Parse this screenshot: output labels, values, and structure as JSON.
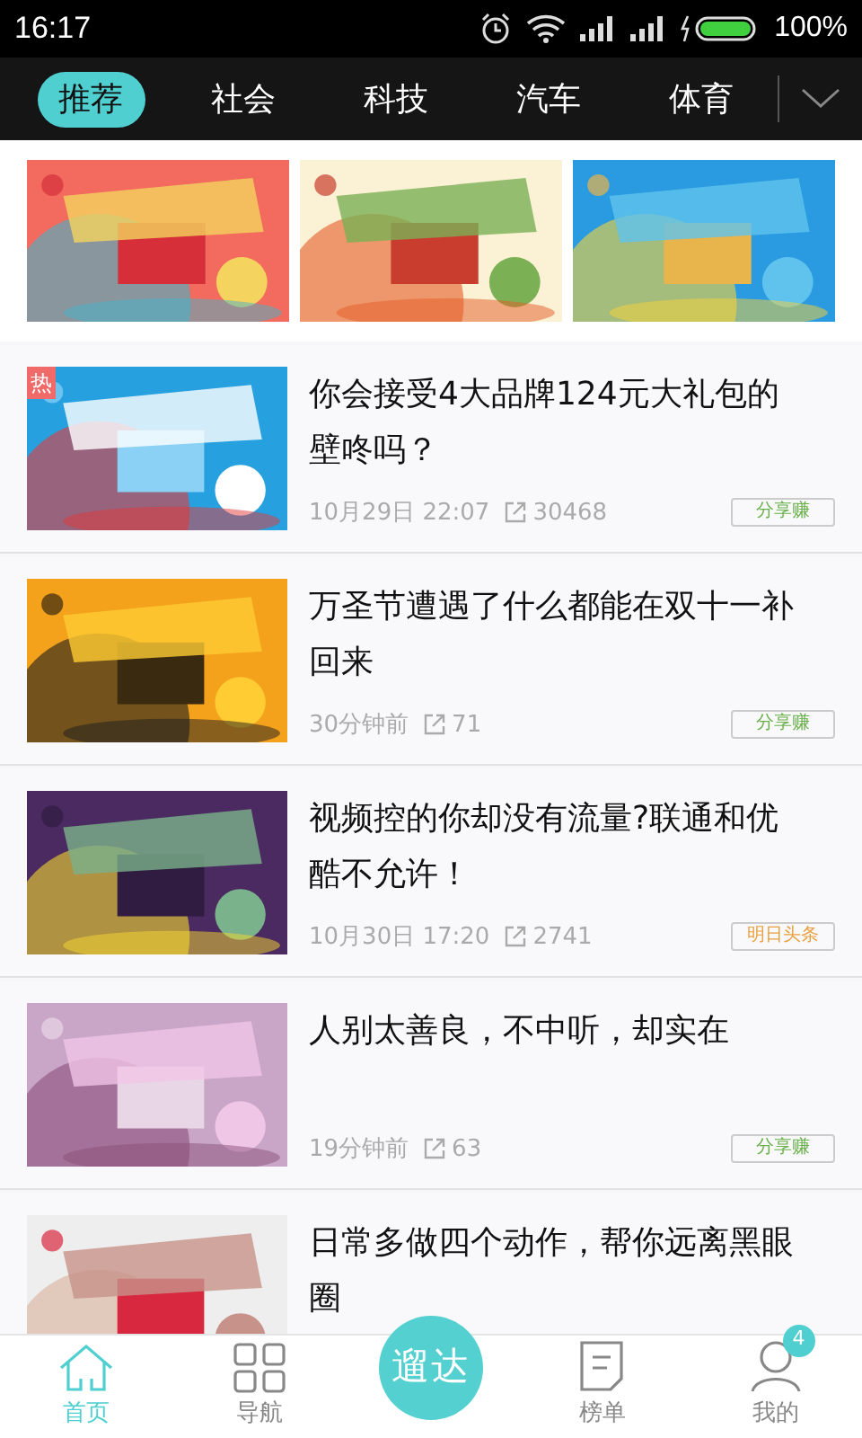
{
  "status_bar": {
    "time": "16:17",
    "battery": "100%"
  },
  "channel_tabs": [
    {
      "label": "推荐",
      "selected": true
    },
    {
      "label": "社会",
      "selected": false
    },
    {
      "label": "科技",
      "selected": false
    },
    {
      "label": "汽车",
      "selected": false
    },
    {
      "label": "体育",
      "selected": false
    }
  ],
  "articles": [
    {
      "title": "你会接受4大品牌124元大礼包的壁咚吗？",
      "badge": "热",
      "time": "10月29日 22:07",
      "shares": "30468",
      "tag": {
        "label": "分享赚",
        "kind": "share"
      }
    },
    {
      "title": "万圣节遭遇了什么都能在双十一补回来",
      "time": "30分钟前",
      "shares": "71",
      "tag": {
        "label": "分享赚",
        "kind": "share"
      }
    },
    {
      "title": "视频控的你却没有流量?联通和优酷不允许！",
      "time": "10月30日 17:20",
      "shares": "2741",
      "tag": {
        "label": "明日头条",
        "kind": "partner"
      }
    },
    {
      "title": "人别太善良，不中听，却实在",
      "time": "19分钟前",
      "shares": "63",
      "tag": {
        "label": "分享赚",
        "kind": "share"
      }
    },
    {
      "title": "日常多做四个动作，帮你远离黑眼圈"
    }
  ],
  "bottom_nav": [
    {
      "label": "首页",
      "kind": "home",
      "selected": true
    },
    {
      "label": "导航",
      "kind": "grid",
      "selected": false
    },
    {
      "label": "遛达",
      "kind": "center",
      "selected": false
    },
    {
      "label": "榜单",
      "kind": "list",
      "selected": false
    },
    {
      "label": "我的",
      "kind": "user",
      "selected": false,
      "badge": "4"
    }
  ]
}
